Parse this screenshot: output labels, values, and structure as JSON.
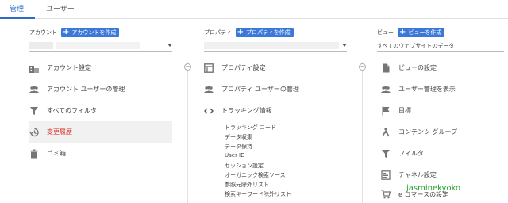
{
  "tabs": [
    {
      "label": "管理",
      "active": true
    },
    {
      "label": "ユーザー",
      "active": false
    }
  ],
  "account": {
    "label": "アカウント",
    "create_button": "アカウントを作成",
    "items": [
      {
        "label": "アカウント設定",
        "icon": "building-icon"
      },
      {
        "label": "アカウント ユーザーの管理",
        "icon": "users-icon"
      },
      {
        "label": "すべてのフィルタ",
        "icon": "filter-icon"
      },
      {
        "label": "変更履歴",
        "icon": "history-icon",
        "highlighted": true
      },
      {
        "label": "ゴミ箱",
        "icon": "trash-icon"
      }
    ]
  },
  "property": {
    "label": "プロパティ",
    "create_button": "プロパティを作成",
    "items": [
      {
        "label": "プロパティ設定",
        "icon": "layout-icon"
      },
      {
        "label": "プロパティ ユーザーの管理",
        "icon": "users-icon"
      },
      {
        "label": "トラッキング情報",
        "icon": "code-icon"
      }
    ],
    "tracking_subitems": [
      "トラッキング コード",
      "データ収集",
      "データ保持",
      "User-ID",
      "セッション設定",
      "オーガニック検索ソース",
      "参照元除外リスト",
      "検索キーワード除外リスト"
    ]
  },
  "view": {
    "label": "ビュー",
    "create_button": "ビューを作成",
    "selected": "すべてのウェブサイトのデータ",
    "items": [
      {
        "label": "ビューの設定",
        "icon": "document-icon"
      },
      {
        "label": "ユーザー管理を表示",
        "icon": "users-icon"
      },
      {
        "label": "目標",
        "icon": "flag-icon"
      },
      {
        "label": "コンテンツ グループ",
        "icon": "person-walk-icon"
      },
      {
        "label": "フィルタ",
        "icon": "filter-icon"
      },
      {
        "label": "チャネル設定",
        "icon": "channel-icon"
      },
      {
        "label": "e コマースの設定",
        "icon": "cart-icon"
      }
    ]
  },
  "watermark": "jasminekyoko",
  "colors": {
    "accent": "#3c78d8",
    "highlight_text": "#d93025",
    "watermark": "#22a12b"
  }
}
